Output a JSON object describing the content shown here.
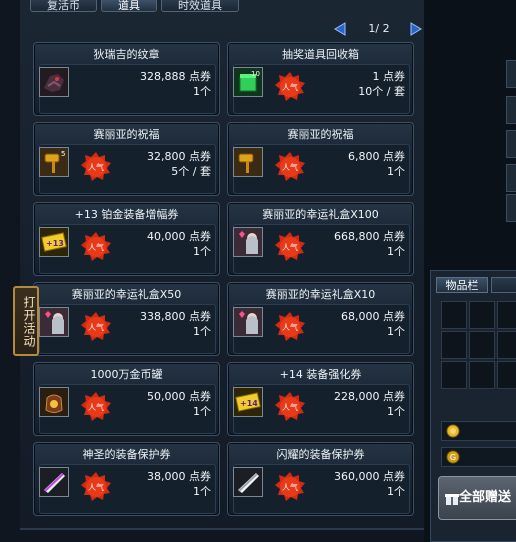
{
  "tabs": [
    "复活币",
    "道具",
    "时效道具"
  ],
  "pager": {
    "text": "1/ 2"
  },
  "hot_label": "人气",
  "side_tab": "打开活动",
  "inventory": {
    "tab": "物品栏"
  },
  "gift_button": "全部赠送",
  "colors": {
    "hot_badge": "#d32a12",
    "side_tab_border": "#b58a3e",
    "pager_arrow": "#2b63c9"
  },
  "items": [
    {
      "name": "狄瑞吉的纹章",
      "price": "328,888 点券",
      "qty": "1个",
      "icon": "dragon-emblem-icon",
      "hot": false
    },
    {
      "name": "抽奖道具回收箱",
      "price": "1 点券",
      "qty": "10个 / 套",
      "icon": "green-recycle-box-icon",
      "hot": true
    },
    {
      "name": "赛丽亚的祝福",
      "price": "32,800 点券",
      "qty": "5个 / 套",
      "icon": "golden-hammer-icon",
      "hot": true
    },
    {
      "name": "赛丽亚的祝福",
      "price": "6,800 点券",
      "qty": "1个",
      "icon": "golden-hammer-icon",
      "hot": true
    },
    {
      "name": "+13 铂金装备增幅券",
      "price": "40,000 点券",
      "qty": "1个",
      "icon": "amplify-ticket-icon",
      "hot": true
    },
    {
      "name": "赛丽亚的幸运礼盒X100",
      "price": "668,800 点券",
      "qty": "1个",
      "icon": "seria-giftbox-icon",
      "hot": true
    },
    {
      "name": "赛丽亚的幸运礼盒X50",
      "price": "338,800 点券",
      "qty": "1个",
      "icon": "seria-giftbox-icon",
      "hot": true
    },
    {
      "name": "赛丽亚的幸运礼盒X10",
      "price": "68,000 点券",
      "qty": "1个",
      "icon": "seria-giftbox-icon",
      "hot": true
    },
    {
      "name": "1000万金币罐",
      "price": "50,000 点券",
      "qty": "1个",
      "icon": "gold-coin-jar-icon",
      "hot": true
    },
    {
      "name": "+14 装备强化券",
      "price": "228,000 点券",
      "qty": "1个",
      "icon": "reinforce-ticket-icon",
      "hot": true
    },
    {
      "name": "神圣的装备保护券",
      "price": "38,000 点券",
      "qty": "1个",
      "icon": "protection-ticket-icon",
      "hot": true
    },
    {
      "name": "闪耀的装备保护券",
      "price": "360,000 点券",
      "qty": "1个",
      "icon": "protection-ticket-icon",
      "hot": true
    }
  ]
}
